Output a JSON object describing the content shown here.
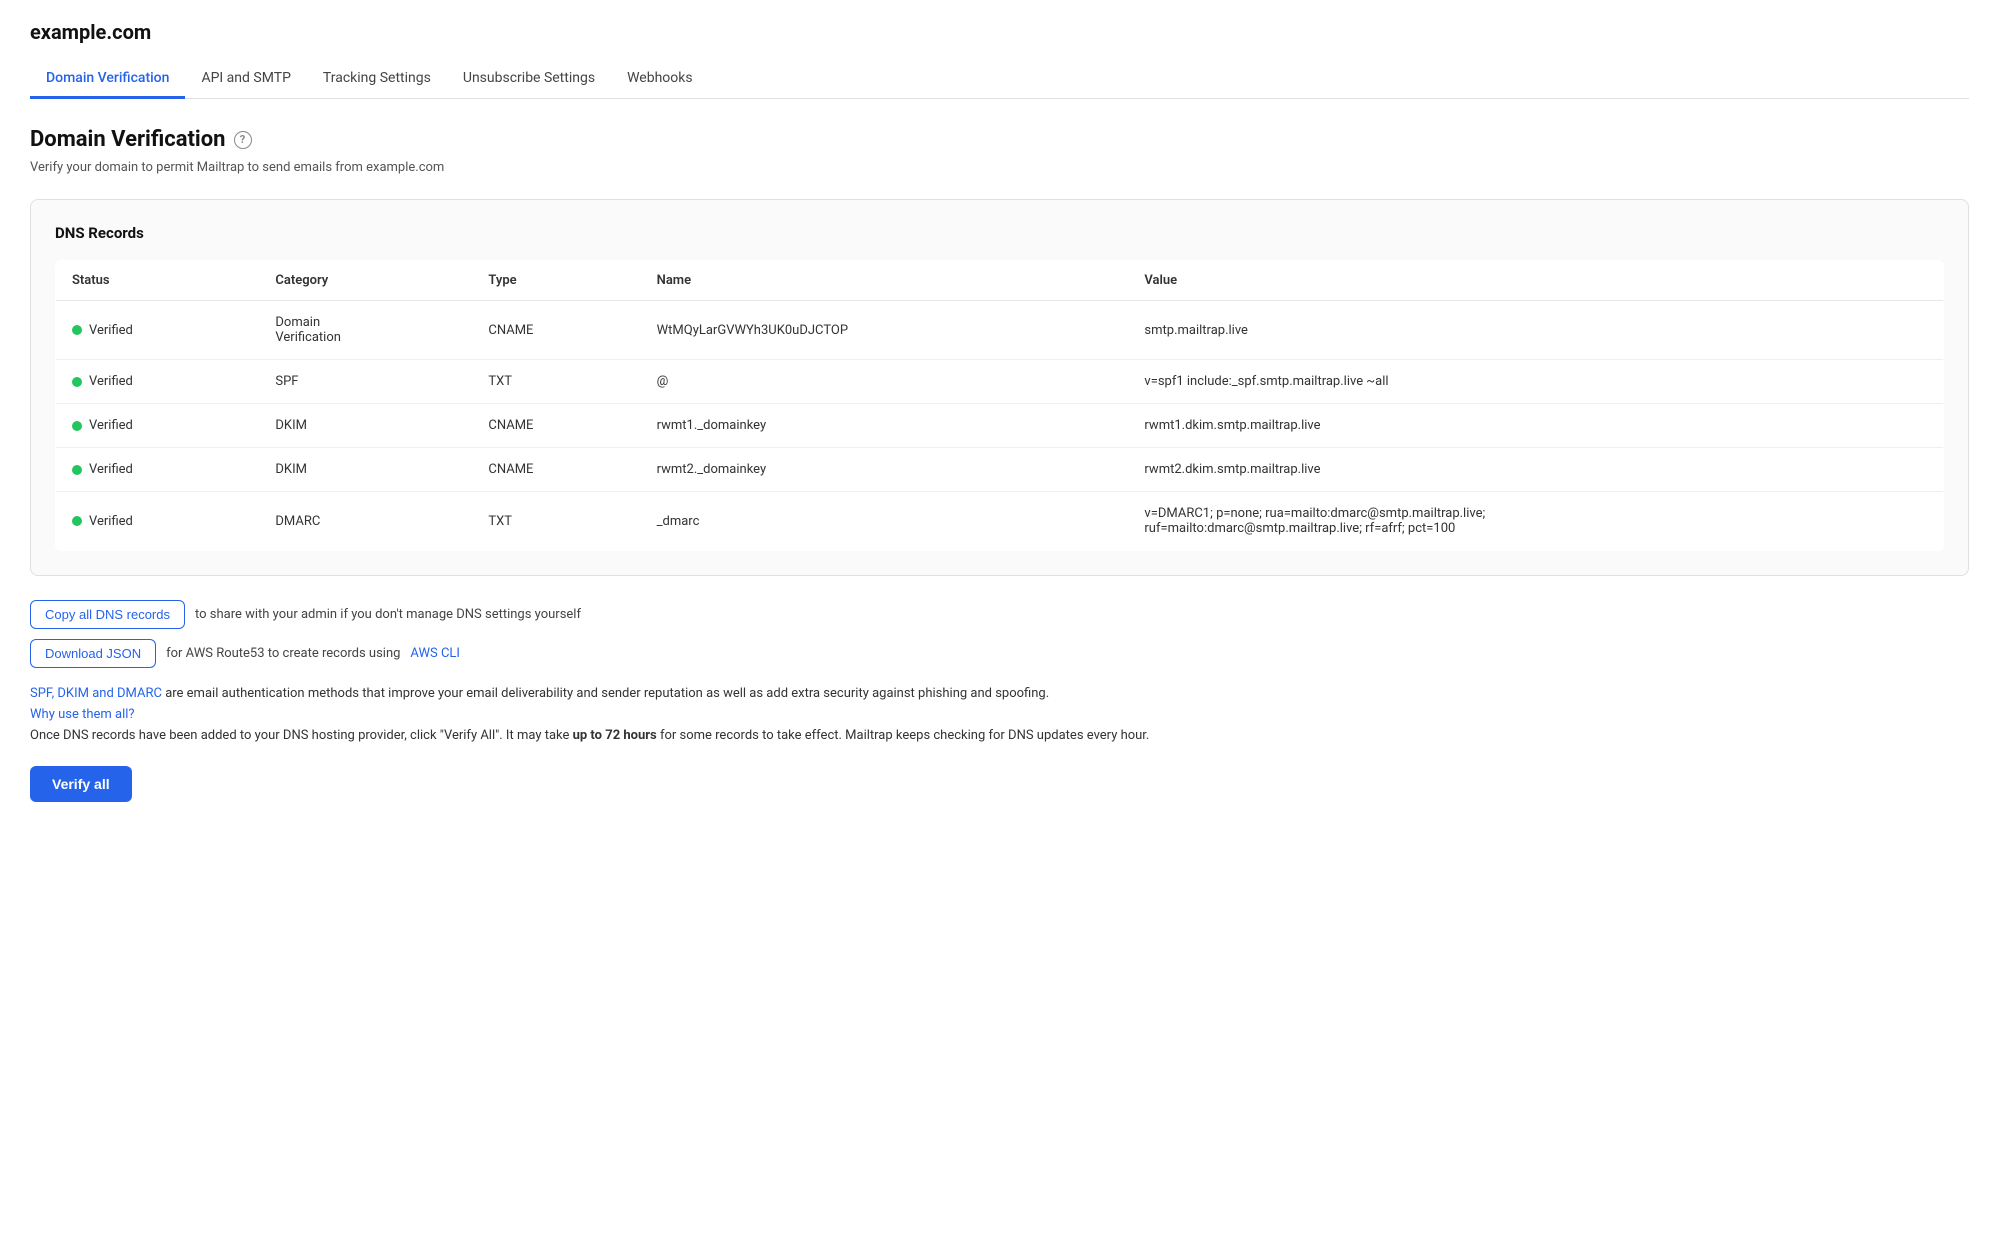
{
  "site": {
    "title": "example.com"
  },
  "tabs": [
    {
      "id": "domain-verification",
      "label": "Domain Verification",
      "active": true
    },
    {
      "id": "api-smtp",
      "label": "API and SMTP",
      "active": false
    },
    {
      "id": "tracking-settings",
      "label": "Tracking Settings",
      "active": false
    },
    {
      "id": "unsubscribe-settings",
      "label": "Unsubscribe Settings",
      "active": false
    },
    {
      "id": "webhooks",
      "label": "Webhooks",
      "active": false
    }
  ],
  "page": {
    "title": "Domain Verification",
    "subtitle": "Verify your domain to permit Mailtrap to send emails from example.com"
  },
  "dnsCard": {
    "title": "DNS Records",
    "columns": [
      "Status",
      "Category",
      "Type",
      "Name",
      "Value"
    ],
    "rows": [
      {
        "status": "Verified",
        "category": "Domain\nVerification",
        "type": "CNAME",
        "name": "WtMQyLarGVWYh3UK0uDJCTOP",
        "value": "smtp.mailtrap.live"
      },
      {
        "status": "Verified",
        "category": "SPF",
        "type": "TXT",
        "name": "@",
        "value": "v=spf1 include:_spf.smtp.mailtrap.live ~all"
      },
      {
        "status": "Verified",
        "category": "DKIM",
        "type": "CNAME",
        "name": "rwmt1._domainkey",
        "value": "rwmt1.dkim.smtp.mailtrap.live"
      },
      {
        "status": "Verified",
        "category": "DKIM",
        "type": "CNAME",
        "name": "rwmt2._domainkey",
        "value": "rwmt2.dkim.smtp.mailtrap.live"
      },
      {
        "status": "Verified",
        "category": "DMARC",
        "type": "TXT",
        "name": "_dmarc",
        "value": "v=DMARC1; p=none; rua=mailto:dmarc@smtp.mailtrap.live;\nruf=mailto:dmarc@smtp.mailtrap.live; rf=afrf; pct=100"
      }
    ]
  },
  "actions": {
    "copyButton": "Copy all DNS records",
    "copyText": "to share with your admin if you don't manage DNS settings yourself",
    "downloadButton": "Download JSON",
    "downloadTextBefore": "for AWS Route53 to create records using ",
    "downloadLinkText": "AWS CLI"
  },
  "info": {
    "linkText": "SPF, DKIM and DMARC",
    "mainText": " are email authentication methods that improve your email deliverability and sender reputation as well as add extra security against phishing and spoofing.",
    "whyText": "Why use them all?",
    "bodyText": "Once DNS records have been added to your DNS hosting provider, click \"Verify All\". It may take ",
    "boldText": "up to 72 hours",
    "bodyTextEnd": " for some records to take effect. Mailtrap keeps checking for DNS updates every hour."
  },
  "verifyButton": "Verify all"
}
